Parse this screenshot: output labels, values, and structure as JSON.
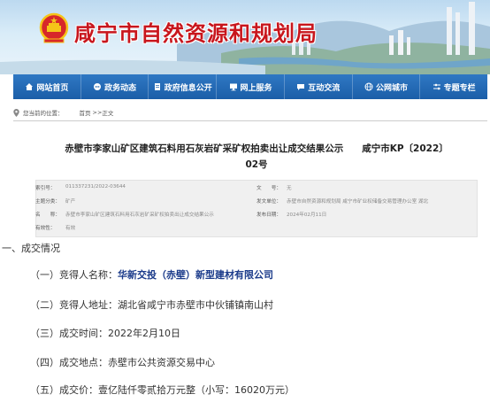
{
  "site": {
    "title": "咸宁市自然资源和规划局",
    "brand_color": "#c8161d",
    "emblem_icon": "national-emblem-icon"
  },
  "nav": {
    "items": [
      {
        "label": "网站首页",
        "icon": "home-icon"
      },
      {
        "label": "政务动态",
        "icon": "chat-icon"
      },
      {
        "label": "政府信息公开",
        "icon": "document-icon"
      },
      {
        "label": "网上服务",
        "icon": "monitor-icon"
      },
      {
        "label": "互动交流",
        "icon": "speech-icon"
      },
      {
        "label": "公网城市",
        "icon": "globe-icon"
      },
      {
        "label": "专题专栏",
        "icon": "sliders-icon"
      }
    ],
    "color": "#1b5ea8"
  },
  "breadcrumb": {
    "prefix": "您当前的位置：",
    "home": "首页",
    "sep": ">>",
    "current": "正文"
  },
  "article": {
    "title_line1": "赤壁市李家山矿区建筑石料用石灰岩矿采矿权拍卖出让成交结果公示　　咸宁市KP〔2022〕",
    "title_line2": "02号",
    "meta": {
      "index_label": "索引号：",
      "index_value": "011337231/2022-03644",
      "fileno_label": "文　　号：",
      "fileno_value": "无",
      "category_label": "主题分类：",
      "category_value": "矿产",
      "publisher_label": "发文单位：",
      "publisher_value": "赤壁市自然资源和规划局 咸宁市矿业权储备交易管理办公室 湖北",
      "name_label": "名　　称：",
      "name_value": "赤壁市李家山矿区建筑石料用石灰岩矿采矿权拍卖出让成交结果公示",
      "date_label": "发布日期：",
      "date_value": "2024年02月11日",
      "validity_label": "有效性：",
      "validity_value": "有效"
    },
    "section_head": "一、成交情况",
    "paragraphs": [
      {
        "label": "（一）竞得人名称：",
        "value": "华新交投（赤壁）新型建材有限公司"
      },
      {
        "label": "（二）竞得人地址：",
        "value": "湖北省咸宁市赤壁市中伙铺镇南山村"
      },
      {
        "label": "（三）成交时间：",
        "value": "2022年2月10日"
      },
      {
        "label": "（四）成交地点：",
        "value": "赤壁市公共资源交易中心"
      },
      {
        "label": "（五）成交价：",
        "value": "壹亿陆仟零贰拾万元整（小写：16020万元）"
      }
    ]
  }
}
